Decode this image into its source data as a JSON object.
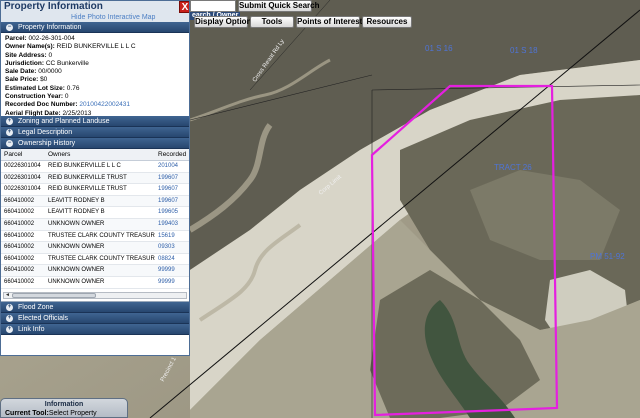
{
  "toolbar": {
    "quick_search_button": "Submit Quick Search",
    "search_caption": "earch / Owner",
    "display_options": "Display Options",
    "tools": "Tools",
    "points_of_interest": "Points of Interest",
    "resources": "Resources"
  },
  "panel": {
    "title": "Property Information",
    "close_glyph": "X",
    "faded_link": "Hide Photo Interactive Map",
    "sections": {
      "property_information": "Property Information",
      "zoning": "Zoning and Planned Landuse",
      "legal": "Legal Description",
      "ownership": "Ownership History",
      "flood": "Flood Zone",
      "elected": "Elected Officials",
      "link_info": "Link Info"
    },
    "info": {
      "parcel_label": "Parcel:",
      "parcel_value": "002-26-301-004",
      "owner_label": "Owner Name(s):",
      "owner_value": "REID BUNKERVILLE L L C",
      "site_label": "Site Address:",
      "site_value": "0",
      "jurisdiction_label": "Jurisdiction:",
      "jurisdiction_value": "CC Bunkerville",
      "sale_date_label": "Sale Date:",
      "sale_date_value": "00/0000",
      "sale_price_label": "Sale Price:",
      "sale_price_value": "$0",
      "lot_size_label": "Estimated Lot Size:",
      "lot_size_value": "0.76",
      "construction_label": "Construction Year:",
      "construction_value": "0",
      "recorded_label": "Recorded Doc Number:",
      "recorded_value": "20100422002431",
      "flight_label": "Aerial Flight Date:",
      "flight_value": "2/25/2013"
    },
    "ownership_table": {
      "headers": [
        "Parcel",
        "Owners",
        "Recorded"
      ],
      "rows": [
        [
          "00226301004",
          "REID BUNKERVILLE L L C",
          "201004"
        ],
        [
          "00226301004",
          "REID BUNKERVILLE TRUST",
          "199607"
        ],
        [
          "00226301004",
          "REID BUNKERVILLE TRUST",
          "199607"
        ],
        [
          "660410002",
          "LEAVITT RODNEY B",
          "199607"
        ],
        [
          "660410002",
          "LEAVITT RODNEY B",
          "199605"
        ],
        [
          "660410002",
          "UNKNOWN OWNER",
          "199403"
        ],
        [
          "660410002",
          "TRUSTEE CLARK COUNTY TREASURER",
          "15619"
        ],
        [
          "660410002",
          "UNKNOWN OWNER",
          "09303"
        ],
        [
          "660410002",
          "TRUSTEE CLARK COUNTY TREASURER",
          "08824"
        ],
        [
          "660410002",
          "UNKNOWN OWNER",
          "99999"
        ],
        [
          "660410002",
          "UNKNOWN OWNER",
          "99999"
        ]
      ],
      "scroll_left_glyph": "◄"
    }
  },
  "bottom_box": {
    "title": "Information",
    "tool_label": "Current Tool:",
    "tool_value": "Select Property"
  },
  "map": {
    "labels": {
      "road_cross": "Cross Reaat Rd Ly",
      "road_corp": "Corp Limit",
      "road_precinct": "Precinct 1",
      "plss_1": "01 S 16",
      "plss_2": "01 S 18",
      "tract": "TRACT 26",
      "pm": "PM 51-92"
    },
    "colors": {
      "selection_outline": "#e51fe0",
      "label_blue": "#4f74d6"
    }
  }
}
